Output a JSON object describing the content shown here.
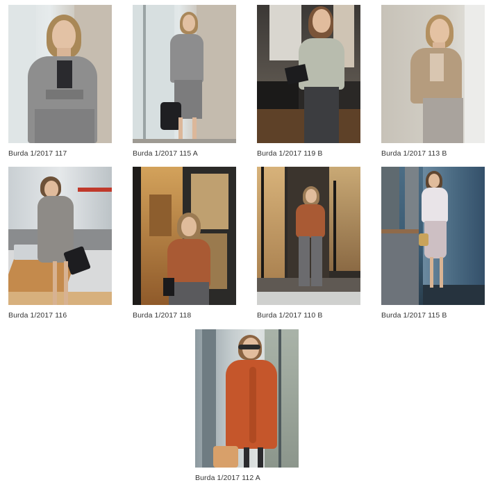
{
  "gallery": {
    "items": [
      {
        "caption": "Burda 1/2017 117"
      },
      {
        "caption": "Burda 1/2017 115 A"
      },
      {
        "caption": "Burda 1/2017 119 B"
      },
      {
        "caption": "Burda 1/2017 113 B"
      },
      {
        "caption": "Burda 1/2017 116"
      },
      {
        "caption": "Burda 1/2017 118"
      },
      {
        "caption": "Burda 1/2017 110 B"
      },
      {
        "caption": "Burda 1/2017 115 B"
      },
      {
        "caption": "Burda 1/2017 112 A"
      }
    ]
  }
}
